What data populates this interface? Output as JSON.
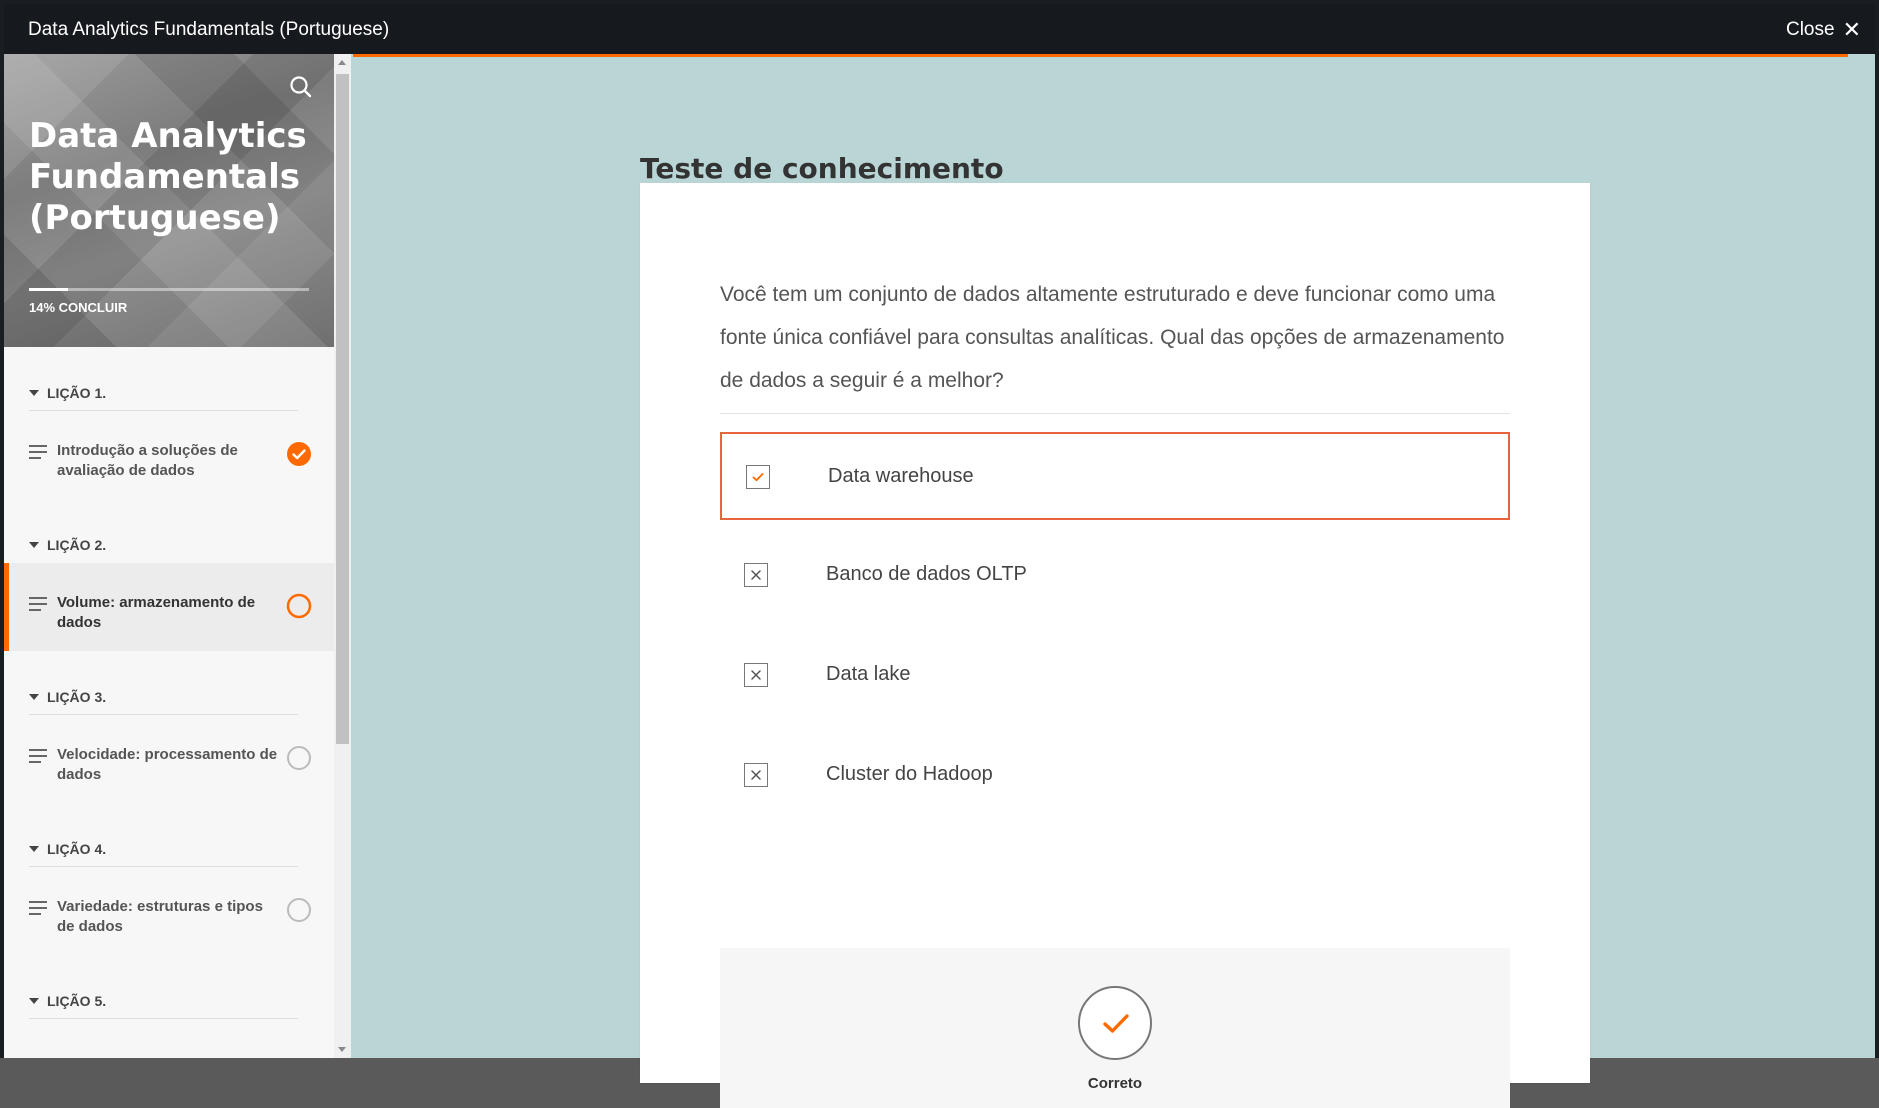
{
  "window": {
    "title": "Data Analytics Fundamentals (Portuguese)",
    "close_label": "Close"
  },
  "sidebar": {
    "course_title": "Data Analytics Fundamentals (Portuguese)",
    "progress_label": "14% CONCLUIR",
    "progress_fraction": 0.14,
    "sections": [
      {
        "label": "LIÇÃO 1.",
        "topic": "Introdução a soluções de avaliação de dados",
        "status": "complete"
      },
      {
        "label": "LIÇÃO 2.",
        "topic": "Volume: armazenamento de dados",
        "status": "in-progress"
      },
      {
        "label": "LIÇÃO 3.",
        "topic": "Velocidade: processamento de dados",
        "status": "not-started"
      },
      {
        "label": "LIÇÃO 4.",
        "topic": "Variedade: estruturas e tipos de dados",
        "status": "not-started"
      },
      {
        "label": "LIÇÃO 5.",
        "topic": "",
        "status": ""
      }
    ]
  },
  "main": {
    "heading": "Teste de conhecimento",
    "question": "Você tem um conjunto de dados altamente estruturado e deve funcionar como uma fonte única confiável para consultas analíticas. Qual das opções de armazenamento de dados a seguir é a melhor?",
    "options": [
      {
        "label": "Data warehouse",
        "state": "correct-selected"
      },
      {
        "label": "Banco de dados OLTP",
        "state": "incorrect"
      },
      {
        "label": "Data lake",
        "state": "incorrect"
      },
      {
        "label": "Cluster do Hadoop",
        "state": "incorrect"
      }
    ],
    "feedback_label": "Correto"
  },
  "colors": {
    "accent": "#ff6a00",
    "background": "#b9d5d5",
    "topbar": "#16191e"
  }
}
